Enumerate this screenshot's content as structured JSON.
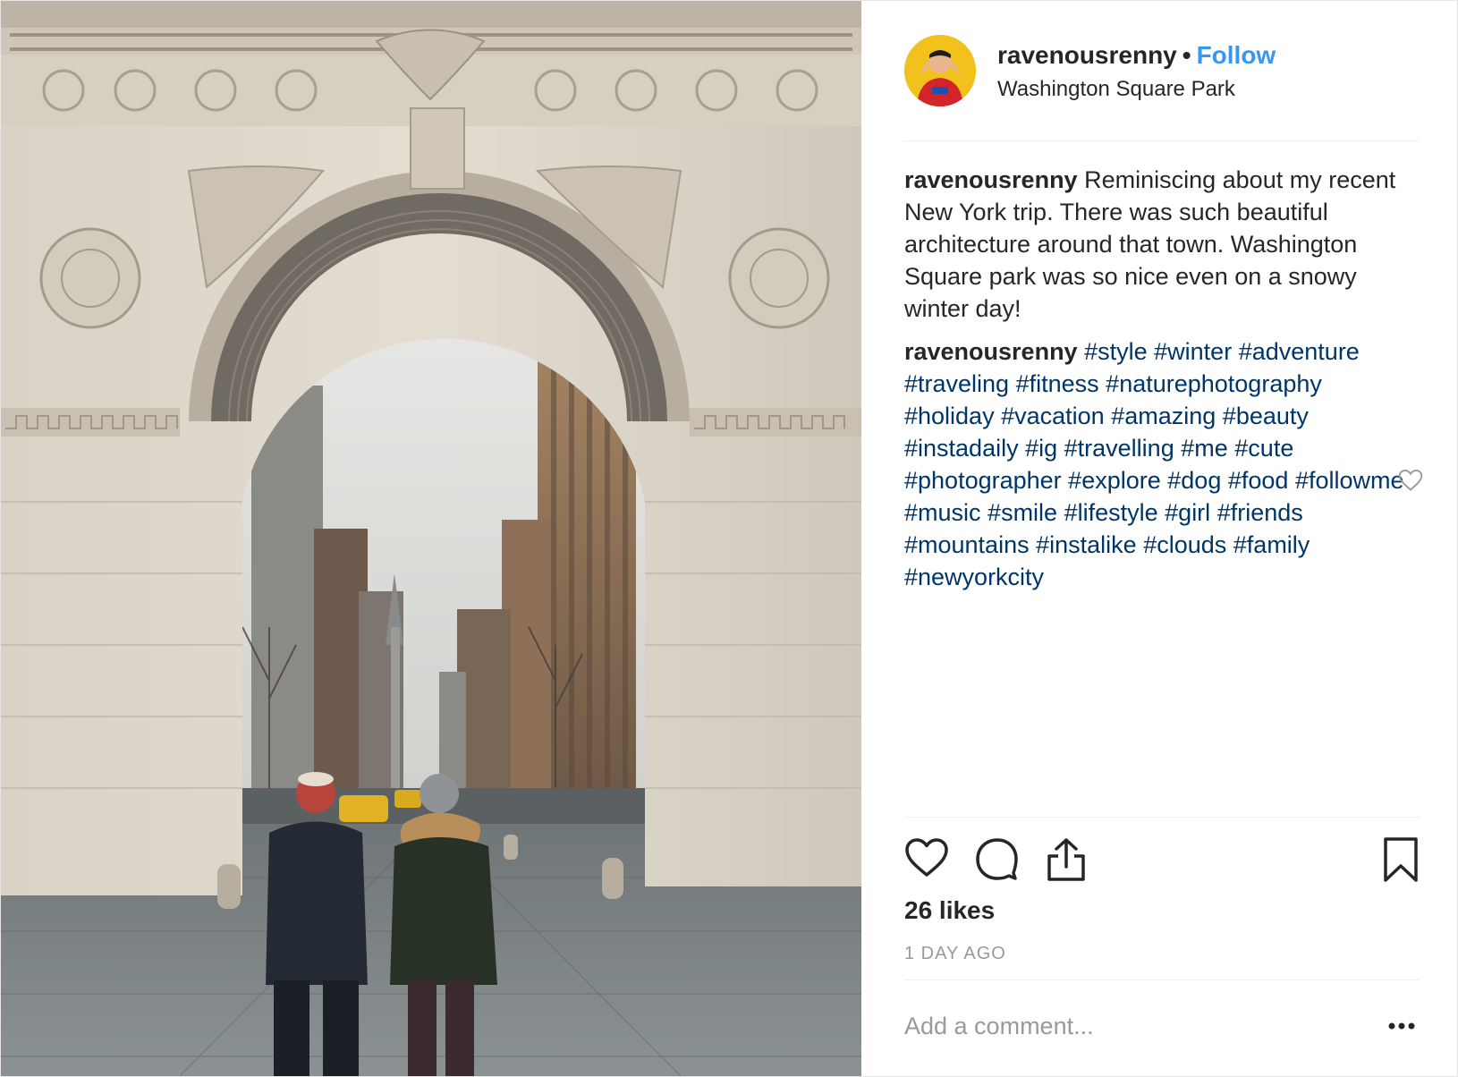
{
  "post": {
    "image_alt": "Washington Square Park arch with two people in winter coats looking toward the city street",
    "header": {
      "username": "ravenousrenny",
      "separator": "•",
      "follow_label": "Follow",
      "location": "Washington Square Park",
      "avatar_icon": "user-avatar"
    },
    "caption": {
      "username": "ravenousrenny",
      "text": "Reminiscing about my recent New York trip. There was such beautiful architecture around that town. Washington Square park was so nice even on a snowy winter day!"
    },
    "hashtag_comment": {
      "username": "ravenousrenny",
      "tags": [
        "#style",
        "#winter",
        "#adventure",
        "#traveling",
        "#fitness",
        "#naturephotography",
        "#holiday",
        "#vacation",
        "#amazing",
        "#beauty",
        "#instadaily",
        "#ig",
        "#travelling",
        "#me",
        "#cute",
        "#photographer",
        "#explore",
        "#dog",
        "#food",
        "#followme",
        "#music",
        "#smile",
        "#lifestyle",
        "#girl",
        "#friends",
        "#mountains",
        "#instalike",
        "#clouds",
        "#family",
        "#newyorkcity"
      ]
    },
    "actions": {
      "like_icon": "heart-icon",
      "comment_icon": "comment-icon",
      "share_icon": "share-icon",
      "save_icon": "bookmark-icon"
    },
    "likes": "26 likes",
    "time_ago": "1 DAY AGO",
    "comment_placeholder": "Add a comment...",
    "more_icon": "more-options-icon"
  },
  "colors": {
    "link_blue": "#3897f0",
    "hashtag": "#003569",
    "muted": "#999999",
    "text": "#262626"
  }
}
